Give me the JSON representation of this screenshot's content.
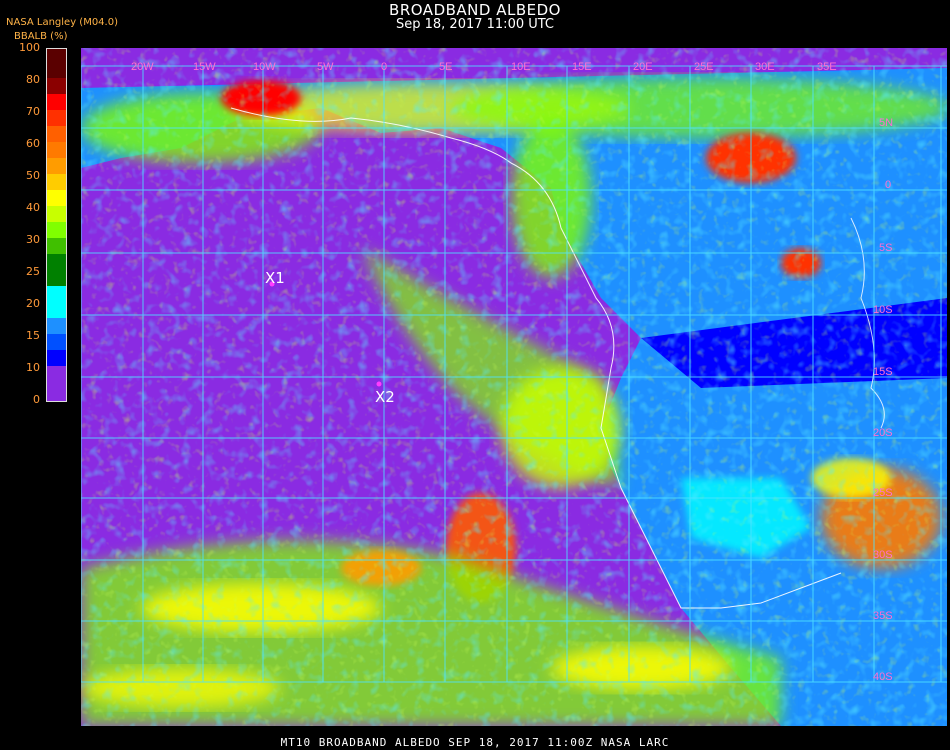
{
  "header": {
    "title": "BROADBAND ALBEDO",
    "subtitle": "Sep 18, 2017 11:00 UTC",
    "source": "NASA Langley (M04.0)",
    "unit_label": "BBALB (%)"
  },
  "legend": {
    "ticks": [
      "100",
      "80",
      "70",
      "60",
      "50",
      "40",
      "30",
      "25",
      "20",
      "15",
      "10",
      "0"
    ],
    "colors": [
      "#5a0000",
      "#8b0000",
      "#ff0000",
      "#ff5a00",
      "#ff9c00",
      "#ffff00",
      "#80ff00",
      "#008000",
      "#00ffff",
      "#1e90ff",
      "#0000ff",
      "#0022cc",
      "#8a2be2"
    ]
  },
  "map": {
    "markers": [
      {
        "label": "X1"
      },
      {
        "label": "X2"
      }
    ],
    "lon_labels": [
      "20W",
      "15W",
      "10W",
      "5W",
      "0",
      "5E",
      "10E",
      "15E",
      "20E",
      "25E",
      "30E",
      "35E"
    ],
    "lat_labels": [
      "5N",
      "0",
      "5S",
      "10S",
      "15S",
      "20S",
      "25S",
      "30S",
      "35S",
      "40S"
    ]
  },
  "footer": "MT10   BROADBAND ALBEDO   SEP 18, 2017 11:00Z   NASA LARC"
}
